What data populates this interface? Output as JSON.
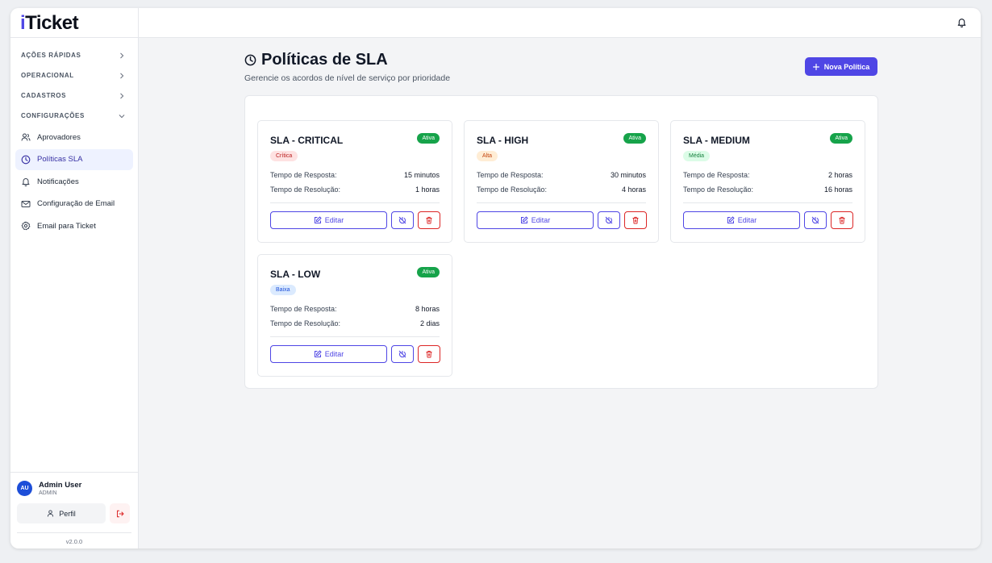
{
  "app": {
    "logo_i": "i",
    "logo_rest": "Ticket"
  },
  "sidebar": {
    "sections": [
      {
        "label": "AÇÕES RÁPIDAS"
      },
      {
        "label": "OPERACIONAL"
      },
      {
        "label": "CADASTROS"
      },
      {
        "label": "CONFIGURAÇÕES"
      }
    ],
    "items": [
      {
        "label": "Aprovadores",
        "icon": "users-icon"
      },
      {
        "label": "Políticas SLA",
        "icon": "clock-icon",
        "active": true
      },
      {
        "label": "Notificações",
        "icon": "bell-icon"
      },
      {
        "label": "Configuração de Email",
        "icon": "mail-icon"
      },
      {
        "label": "Email para Ticket",
        "icon": "gear-icon"
      }
    ],
    "user": {
      "initials": "AU",
      "name": "Admin User",
      "role": "ADMIN"
    },
    "perfil_label": "Perfil",
    "version": "v2.0.0"
  },
  "page": {
    "title": "Políticas de SLA",
    "subtitle": "Gerencie os acordos de nível de serviço por prioridade",
    "new_button": "Nova Política"
  },
  "labels": {
    "response": "Tempo de Resposta:",
    "resolution": "Tempo de Resolução:",
    "edit": "Editar",
    "active": "Ativa"
  },
  "policies": [
    {
      "name": "SLA - CRITICAL",
      "priority": "Crítica",
      "response": "15 minutos",
      "resolution": "1 horas",
      "status": "Ativa"
    },
    {
      "name": "SLA - HIGH",
      "priority": "Alta",
      "response": "30 minutos",
      "resolution": "4 horas",
      "status": "Ativa"
    },
    {
      "name": "SLA - MEDIUM",
      "priority": "Média",
      "response": "2 horas",
      "resolution": "16 horas",
      "status": "Ativa"
    },
    {
      "name": "SLA - LOW",
      "priority": "Baixa",
      "response": "8 horas",
      "resolution": "2 dias",
      "status": "Ativa"
    }
  ],
  "colors": {
    "accent": "#4f46e5",
    "active_badge": "#16a34a",
    "critical_bg": "#fee2e2",
    "critical_fg": "#b91c1c",
    "high_bg": "#ffedd5",
    "high_fg": "#c2410c",
    "medium_bg": "#dcfce7",
    "medium_fg": "#15803d",
    "low_bg": "#dbeafe",
    "low_fg": "#1d4ed8"
  }
}
